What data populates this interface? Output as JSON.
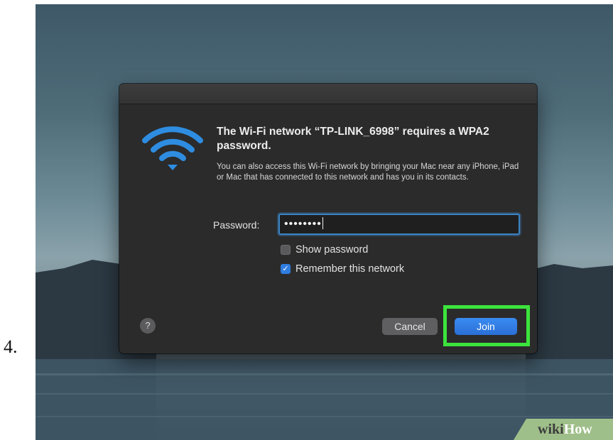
{
  "step": {
    "number": "4."
  },
  "dialog": {
    "heading": "The Wi-Fi network “TP-LINK_6998” requires a WPA2 password.",
    "body": "You can also access this Wi-Fi network by bringing your Mac near any iPhone, iPad or Mac that has connected to this network and has you in its contacts.",
    "password_label": "Password:",
    "password_value": "••••••••",
    "show_password": {
      "label": "Show password",
      "checked": false
    },
    "remember_network": {
      "label": "Remember this network",
      "checked": true,
      "check_glyph": "✓"
    },
    "help_label": "?",
    "cancel_label": "Cancel",
    "join_label": "Join"
  },
  "icons": {
    "wifi": "wifi-icon",
    "help": "question-mark-icon"
  },
  "colors": {
    "dialog_background": "#2b2b2c",
    "accent_blue": "#2f7de1",
    "highlight_green": "#3ce33c",
    "wifi_blue": "#2e8de0"
  },
  "watermark": {
    "part1": "wiki",
    "part2": "How"
  }
}
